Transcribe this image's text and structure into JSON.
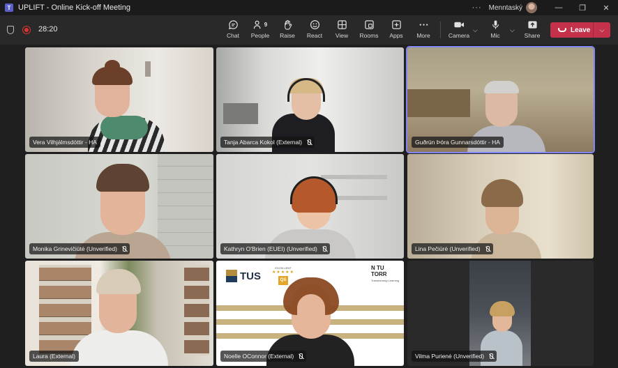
{
  "window": {
    "title": "UPLIFT - Online Kick-off Meeting",
    "user_name": "Menntaský",
    "more": "···",
    "minimize": "—",
    "maximize": "❐",
    "close": "✕"
  },
  "meeting": {
    "timer": "28:20"
  },
  "toolbar": {
    "chat": "Chat",
    "people": "People",
    "people_count": "9",
    "raise": "Raise",
    "react": "React",
    "view": "View",
    "rooms": "Rooms",
    "apps": "Apps",
    "more": "More",
    "camera": "Camera",
    "mic": "Mic",
    "share": "Share",
    "leave": "Leave"
  },
  "participants": [
    {
      "name": "Vera Vilhjálmsdóttir - HA",
      "muted": false
    },
    {
      "name": "Tanja Abarca Kokol (External)",
      "muted": true
    },
    {
      "name": "Guðrún Þóra Gunnarsdóttir - HA",
      "muted": false,
      "active": true
    },
    {
      "name": "Monika Grinevičiūtė (Unverified)",
      "muted": true
    },
    {
      "name": "Kathryn O'Brien (EUEI) (Unverified)",
      "muted": true
    },
    {
      "name": "Lina Pečiūrė (Unverified)",
      "muted": true
    },
    {
      "name": "Laura (External)",
      "muted": false
    },
    {
      "name": "Noelle OConnor (External)",
      "muted": true
    },
    {
      "name": "Vilma Purienė (Unverified)",
      "muted": true
    }
  ],
  "backgrounds": {
    "tus_logo": "TUS",
    "excellence_label": "EXCELLENT",
    "qs_label": "QS",
    "tutorr_logo": "N TU TORR",
    "tutorr_tagline": "Transforming Learning"
  }
}
